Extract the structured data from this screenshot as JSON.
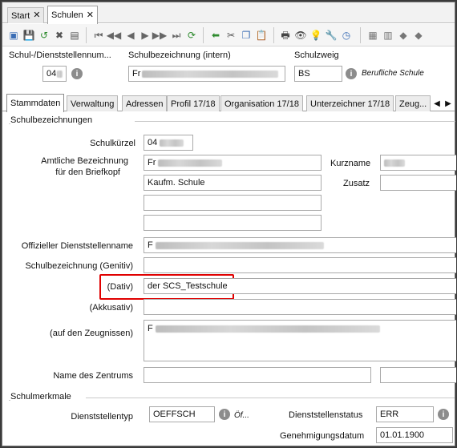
{
  "doc_tabs": [
    {
      "label": "Start",
      "active": false
    },
    {
      "label": "Schulen",
      "active": true
    }
  ],
  "header": {
    "school_number_label": "Schul-/Dienststellennum...",
    "school_number_value": "04",
    "school_name_label": "Schulbezeichnung (intern)",
    "school_name_value": "Fr",
    "branch_label": "Schulzweig",
    "branch_value": "BS",
    "branch_desc": "Berufliche Schule"
  },
  "section_tabs": [
    {
      "label": "Stammdaten",
      "active": true
    },
    {
      "label": "Verwaltung",
      "active": false
    },
    {
      "label": "Adressen",
      "active": false
    },
    {
      "label": "Profil 17/18",
      "active": false
    },
    {
      "label": "Organisation 17/18",
      "active": false
    },
    {
      "label": "Unterzeichner 17/18",
      "active": false
    },
    {
      "label": "Zeug...",
      "active": false
    }
  ],
  "group_names": {
    "title": "Schulbezeichnungen",
    "kuerzel_label": "Schulkürzel",
    "kuerzel_value": "04",
    "amtlich_label_1": "Amtliche Bezeichnung",
    "amtlich_label_2": "für den Briefkopf",
    "amtlich_line1": "Fr",
    "amtlich_line2": "Kaufm. Schule",
    "amtlich_line3": "",
    "amtlich_line4": "",
    "kurzname_label": "Kurzname",
    "zusatz_label": "Zusatz",
    "offiziell_label": "Offizieller Dienststellenname",
    "offiziell_value": "F",
    "genitiv_label": "Schulbezeichnung (Genitiv)",
    "genitiv_value": "",
    "dativ_label": "(Dativ)",
    "dativ_value": "der SCS_Testschule",
    "akkusativ_label": "(Akkusativ)",
    "akkusativ_value": "",
    "zeugnis_label": "(auf den Zeugnissen)",
    "zeugnis_value": "F",
    "zentrum_label": "Name des Zentrums",
    "zentrum_value": ""
  },
  "group_merkmale": {
    "title": "Schulmerkmale",
    "typ_label": "Dienststellentyp",
    "typ_value": "OEFFSCH",
    "typ_desc": "Öf...",
    "status_label": "Dienststellenstatus",
    "status_value": "ERR",
    "genehmigung_label": "Genehmigungsdatum",
    "genehmigung_value": "01.01.1900"
  },
  "toolbar_icons": [
    "edit-icon",
    "save-icon",
    "undo-icon",
    "delete-icon",
    "form-icon",
    "first-icon",
    "prev-page-icon",
    "prev-icon",
    "next-icon",
    "next-page-icon",
    "last-icon",
    "refresh-icon",
    "back-arrow-icon",
    "cut-icon",
    "copy-icon",
    "paste-icon",
    "print-icon",
    "preview-icon",
    "bulb-icon",
    "tools-icon",
    "clock-icon",
    "grid-icon",
    "list-icon",
    "brush-icon",
    "paint-icon"
  ],
  "colors": {
    "highlight": "#e00000",
    "info_dot": "#8c8c8c"
  }
}
